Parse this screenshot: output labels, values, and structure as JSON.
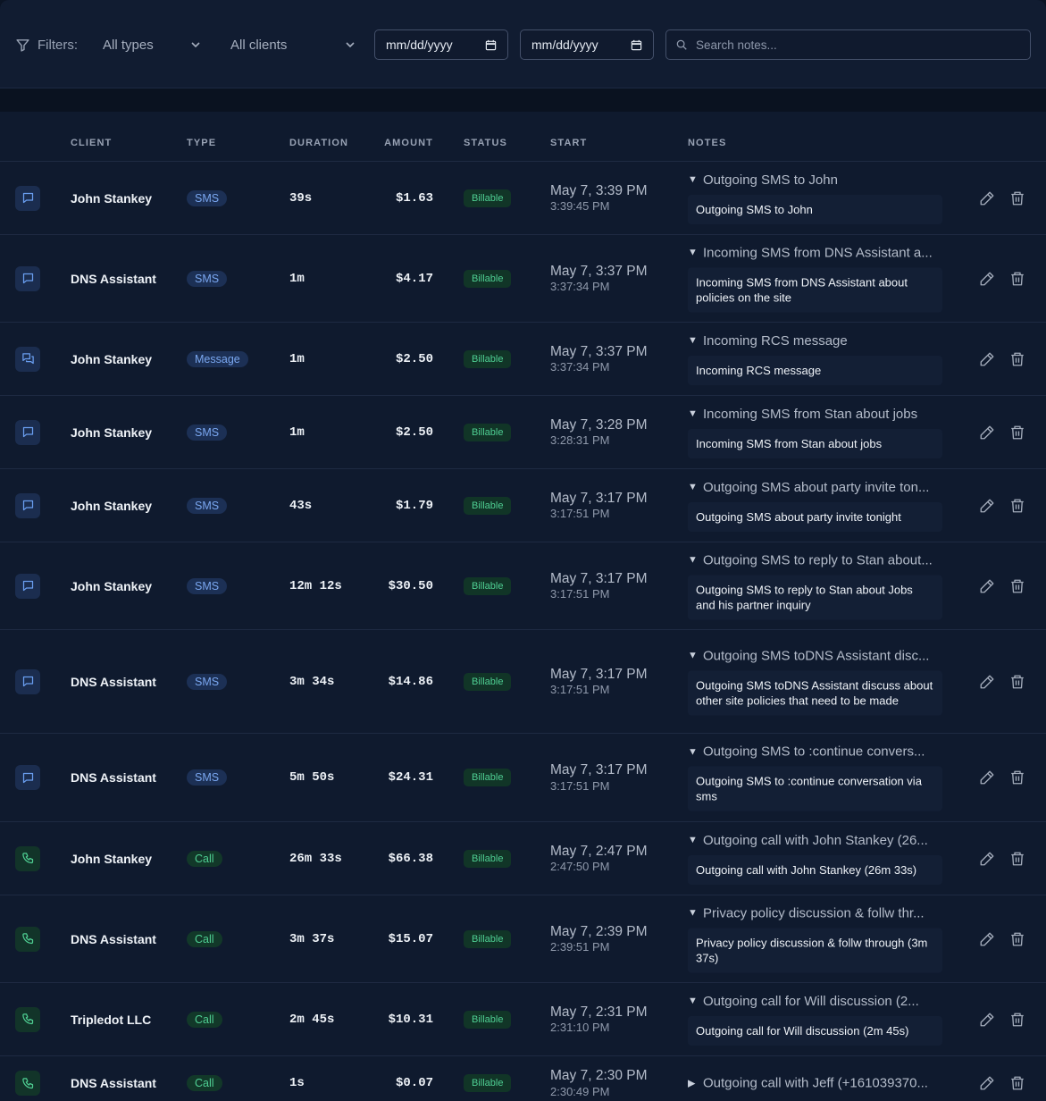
{
  "filters": {
    "label": "Filters:",
    "type_select": "All types",
    "client_select": "All clients",
    "date_from": "mm/dd/yyyy",
    "date_to": "mm/dd/yyyy",
    "search_placeholder": "Search notes..."
  },
  "table": {
    "headers": {
      "client": "CLIENT",
      "type": "TYPE",
      "duration": "DURATION",
      "amount": "AMOUNT",
      "status": "STATUS",
      "start": "START",
      "notes": "NOTES"
    },
    "rows": [
      {
        "icon": "chat-icon",
        "client": "John Stankey",
        "type": "SMS",
        "duration": "39s",
        "amount": "$1.63",
        "status": "Billable",
        "start_date": "May 7, 3:39 PM",
        "start_time": "3:39:45 PM",
        "note_summary": "Outgoing SMS to John",
        "note_body": "Outgoing SMS to John"
      },
      {
        "icon": "chat-icon",
        "client": "DNS Assistant",
        "type": "SMS",
        "duration": "1m",
        "amount": "$4.17",
        "status": "Billable",
        "start_date": "May 7, 3:37 PM",
        "start_time": "3:37:34 PM",
        "note_summary": "Incoming SMS from DNS Assistant a...",
        "note_body": "Incoming SMS from DNS Assistant about policies on the site"
      },
      {
        "icon": "chats-icon",
        "client": "John Stankey",
        "type": "Message",
        "duration": "1m",
        "amount": "$2.50",
        "status": "Billable",
        "start_date": "May 7, 3:37 PM",
        "start_time": "3:37:34 PM",
        "note_summary": "Incoming RCS message",
        "note_body": "Incoming RCS message"
      },
      {
        "icon": "chat-icon",
        "client": "John Stankey",
        "type": "SMS",
        "duration": "1m",
        "amount": "$2.50",
        "status": "Billable",
        "start_date": "May 7, 3:28 PM",
        "start_time": "3:28:31 PM",
        "note_summary": "Incoming SMS from Stan about jobs",
        "note_body": "Incoming SMS from Stan about jobs"
      },
      {
        "icon": "chat-icon",
        "client": "John Stankey",
        "type": "SMS",
        "duration": "43s",
        "amount": "$1.79",
        "status": "Billable",
        "start_date": "May 7, 3:17 PM",
        "start_time": "3:17:51 PM",
        "note_summary": "Outgoing SMS about party invite ton...",
        "note_body": "Outgoing SMS about party invite tonight"
      },
      {
        "icon": "chat-icon",
        "client": "John Stankey",
        "type": "SMS",
        "duration": "12m 12s",
        "amount": "$30.50",
        "status": "Billable",
        "start_date": "May 7, 3:17 PM",
        "start_time": "3:17:51 PM",
        "note_summary": "Outgoing SMS to reply to Stan about...",
        "note_body": "Outgoing SMS to reply to Stan about Jobs and his partner inquiry"
      },
      {
        "icon": "chat-icon",
        "client": "DNS Assistant",
        "type": "SMS",
        "duration": "3m 34s",
        "amount": "$14.86",
        "status": "Billable",
        "start_date": "May 7, 3:17 PM",
        "start_time": "3:17:51 PM",
        "note_summary": "Outgoing SMS toDNS Assistant disc...",
        "note_body": "Outgoing SMS toDNS Assistant discuss about other site policies that need to be made"
      },
      {
        "icon": "chat-icon",
        "client": "DNS Assistant",
        "type": "SMS",
        "duration": "5m 50s",
        "amount": "$24.31",
        "status": "Billable",
        "start_date": "May 7, 3:17 PM",
        "start_time": "3:17:51 PM",
        "note_summary": "Outgoing SMS to :continue convers...",
        "note_body": "Outgoing SMS to :continue conversation via sms"
      },
      {
        "icon": "phone-icon",
        "client": "John Stankey",
        "type": "Call",
        "duration": "26m 33s",
        "amount": "$66.38",
        "status": "Billable",
        "start_date": "May 7, 2:47 PM",
        "start_time": "2:47:50 PM",
        "note_summary": "Outgoing call with John Stankey (26...",
        "note_body": "Outgoing call with John Stankey  (26m 33s)"
      },
      {
        "icon": "phone-icon",
        "client": "DNS Assistant",
        "type": "Call",
        "duration": "3m 37s",
        "amount": "$15.07",
        "status": "Billable",
        "start_date": "May 7, 2:39 PM",
        "start_time": "2:39:51 PM",
        "note_summary": "Privacy policy discussion & follw thr...",
        "note_body": "Privacy policy discussion & follw through (3m 37s)"
      },
      {
        "icon": "phone-icon",
        "client": "Tripledot LLC",
        "type": "Call",
        "duration": "2m 45s",
        "amount": "$10.31",
        "status": "Billable",
        "start_date": "May 7, 2:31 PM",
        "start_time": "2:31:10 PM",
        "note_summary": "Outgoing call for Will discussion (2...",
        "note_body": "Outgoing call for Will discussion (2m 45s)"
      },
      {
        "icon": "phone-icon",
        "client": "DNS Assistant",
        "type": "Call",
        "duration": "1s",
        "amount": "$0.07",
        "status": "Billable",
        "start_date": "May 7, 2:30 PM",
        "start_time": "2:30:49 PM",
        "note_summary": "Outgoing call with Jeff (+161039370...",
        "note_body": ""
      }
    ]
  }
}
